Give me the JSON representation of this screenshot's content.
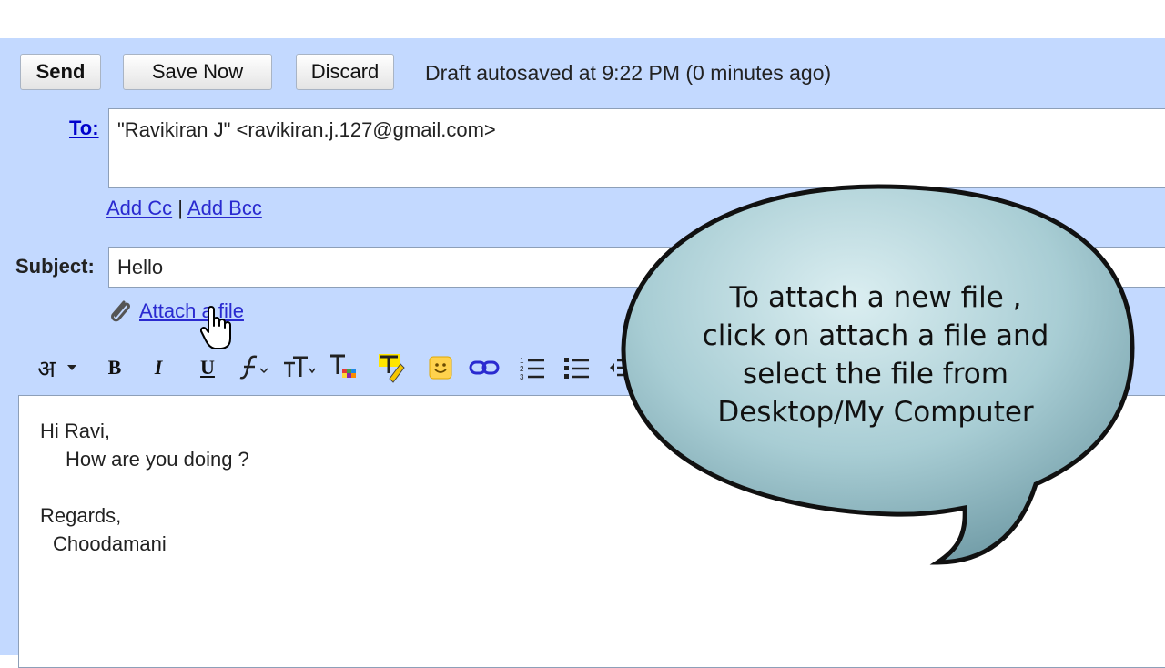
{
  "toolbar": {
    "send_label": "Send",
    "save_label": "Save Now",
    "discard_label": "Discard",
    "status": "Draft autosaved at 9:22 PM (0 minutes ago)"
  },
  "recipients": {
    "to_label": "To:",
    "to_value": "\"Ravikiran J\" <ravikiran.j.127@gmail.com>",
    "add_cc": "Add Cc",
    "separator": "|",
    "add_bcc": "Add Bcc"
  },
  "subject": {
    "label": "Subject:",
    "value": "Hello"
  },
  "attach": {
    "label": "Attach a file"
  },
  "format_toolbar": {
    "hindi_glyph": "अ",
    "bold": "B",
    "italic": "I",
    "underline": "U",
    "icons": [
      "hindi-transliterate-icon",
      "bold-icon",
      "italic-icon",
      "underline-icon",
      "font-icon",
      "font-size-icon",
      "text-color-icon",
      "highlight-color-icon",
      "emoticon-icon",
      "link-icon",
      "numbered-list-icon",
      "bullet-list-icon",
      "indent-icon"
    ]
  },
  "message_body": {
    "lines": [
      "Hi Ravi,",
      "How are you doing ?",
      "",
      "Regards,",
      "Choodamani"
    ]
  },
  "callout": {
    "lines": [
      "To attach a new file ,",
      "click on attach a file and",
      "select the file from",
      "Desktop/My Computer"
    ]
  },
  "colors": {
    "compose_bg": "#c3d9ff",
    "link": "#2a2ad0",
    "bubble_fill": "#9ec5cc"
  }
}
